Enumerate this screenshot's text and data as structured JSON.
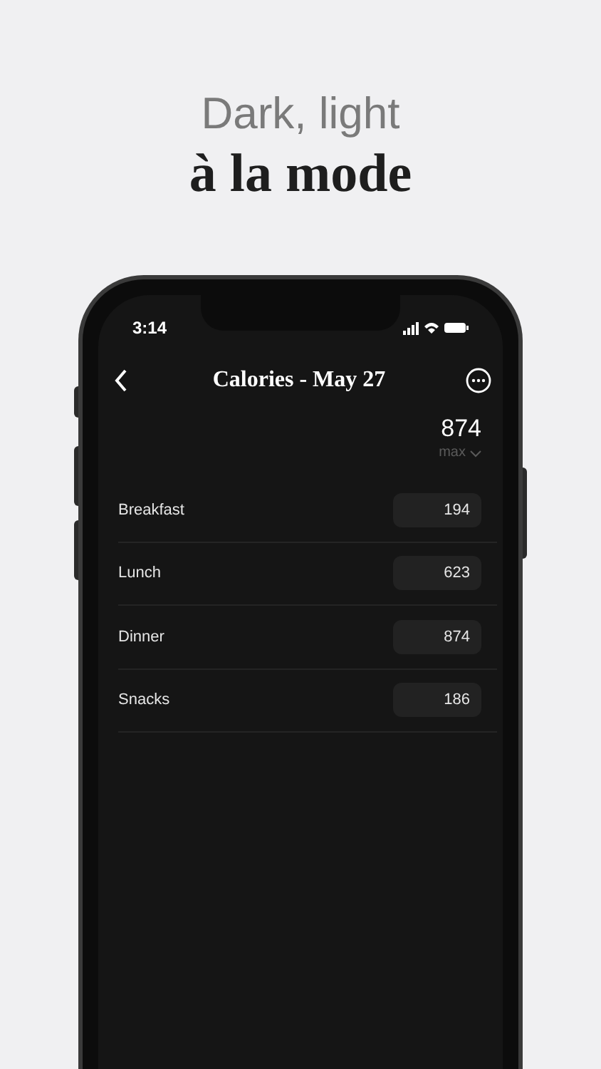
{
  "headline": {
    "line_1": "Dark, light",
    "line_2": "à la mode"
  },
  "status_bar": {
    "time": "3:14"
  },
  "nav": {
    "title": "Calories - May 27"
  },
  "summary": {
    "value": "874",
    "label": "max"
  },
  "meals": [
    {
      "name": "Breakfast",
      "calories": "194"
    },
    {
      "name": "Lunch",
      "calories": "623"
    },
    {
      "name": "Dinner",
      "calories": "874"
    },
    {
      "name": "Snacks",
      "calories": "186"
    }
  ]
}
